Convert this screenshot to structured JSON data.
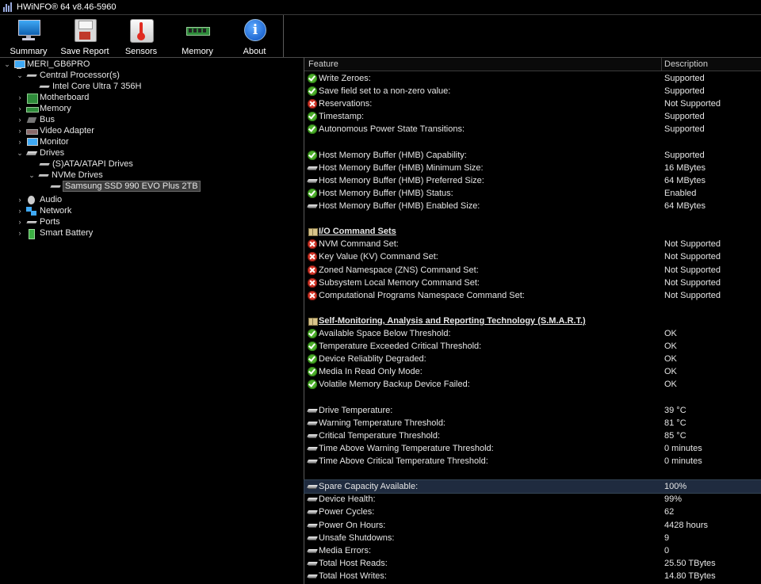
{
  "window": {
    "title": "HWiNFO® 64 v8.46-5960"
  },
  "toolbar": {
    "buttons": [
      {
        "label": "Summary",
        "icon": "monitor-icon"
      },
      {
        "label": "Save Report",
        "icon": "floppy-disk-icon"
      },
      {
        "label": "Sensors",
        "icon": "thermometer-icon"
      },
      {
        "label": "Memory",
        "icon": "memory-module-icon"
      },
      {
        "label": "About",
        "icon": "info-icon"
      }
    ]
  },
  "tree": {
    "root": "MERI_GB6PRO",
    "cpu": "Central Processor(s)",
    "cpu_child": "Intel Core Ultra 7 356H",
    "motherboard": "Motherboard",
    "memory": "Memory",
    "bus": "Bus",
    "video": "Video Adapter",
    "monitor": "Monitor",
    "drives": "Drives",
    "sata": "(S)ATA/ATAPI Drives",
    "nvme": "NVMe Drives",
    "ssd": "Samsung SSD 990 EVO Plus 2TB",
    "audio": "Audio",
    "network": "Network",
    "ports": "Ports",
    "battery": "Smart Battery"
  },
  "details": {
    "header_feature": "Feature",
    "header_description": "Description",
    "rows": [
      {
        "icon": "ok",
        "feature": "Write Zeroes:",
        "value": "Supported"
      },
      {
        "icon": "ok",
        "feature": "Save field set to a non-zero value:",
        "value": "Supported"
      },
      {
        "icon": "no",
        "feature": "Reservations:",
        "value": "Not Supported"
      },
      {
        "icon": "ok",
        "feature": "Timestamp:",
        "value": "Supported"
      },
      {
        "icon": "ok",
        "feature": "Autonomous Power State Transitions:",
        "value": "Supported"
      },
      {
        "icon": "",
        "feature": "",
        "value": ""
      },
      {
        "icon": "ok",
        "feature": "Host Memory Buffer (HMB) Capability:",
        "value": "Supported"
      },
      {
        "icon": "disk",
        "feature": "Host Memory Buffer (HMB) Minimum Size:",
        "value": "16 MBytes"
      },
      {
        "icon": "disk",
        "feature": "Host Memory Buffer (HMB) Preferred Size:",
        "value": "64 MBytes"
      },
      {
        "icon": "ok",
        "feature": "Host Memory Buffer (HMB) Status:",
        "value": "Enabled"
      },
      {
        "icon": "disk",
        "feature": "Host Memory Buffer (HMB) Enabled Size:",
        "value": "64 MBytes"
      },
      {
        "icon": "",
        "feature": "",
        "value": ""
      },
      {
        "icon": "book",
        "feature": "I/O Command Sets",
        "value": "",
        "section": true
      },
      {
        "icon": "no",
        "feature": "NVM Command Set:",
        "value": "Not Supported"
      },
      {
        "icon": "no",
        "feature": "Key Value (KV) Command Set:",
        "value": "Not Supported"
      },
      {
        "icon": "no",
        "feature": "Zoned Namespace (ZNS) Command Set:",
        "value": "Not Supported"
      },
      {
        "icon": "no",
        "feature": "Subsystem Local Memory Command Set:",
        "value": "Not Supported"
      },
      {
        "icon": "no",
        "feature": "Computational Programs Namespace Command Set:",
        "value": "Not Supported"
      },
      {
        "icon": "",
        "feature": "",
        "value": ""
      },
      {
        "icon": "book",
        "feature": "Self-Monitoring, Analysis and Reporting Technology (S.M.A.R.T.)",
        "value": "",
        "section": true
      },
      {
        "icon": "ok",
        "feature": "Available Space Below Threshold:",
        "value": "OK"
      },
      {
        "icon": "ok",
        "feature": "Temperature Exceeded Critical Threshold:",
        "value": "OK"
      },
      {
        "icon": "ok",
        "feature": "Device Reliablity Degraded:",
        "value": "OK"
      },
      {
        "icon": "ok",
        "feature": "Media In Read Only Mode:",
        "value": "OK"
      },
      {
        "icon": "ok",
        "feature": "Volatile Memory Backup Device Failed:",
        "value": "OK"
      },
      {
        "icon": "",
        "feature": "",
        "value": ""
      },
      {
        "icon": "disk",
        "feature": "Drive Temperature:",
        "value": "39 °C"
      },
      {
        "icon": "disk",
        "feature": "Warning Temperature Threshold:",
        "value": "81 °C"
      },
      {
        "icon": "disk",
        "feature": "Critical Temperature Threshold:",
        "value": "85 °C"
      },
      {
        "icon": "disk",
        "feature": "Time Above Warning Temperature Threshold:",
        "value": "0 minutes"
      },
      {
        "icon": "disk",
        "feature": "Time Above Critical Temperature Threshold:",
        "value": "0 minutes"
      },
      {
        "icon": "",
        "feature": "",
        "value": ""
      },
      {
        "icon": "disk",
        "feature": "Spare Capacity Available:",
        "value": "100%",
        "selected": true
      },
      {
        "icon": "disk",
        "feature": "Device Health:",
        "value": "99%"
      },
      {
        "icon": "disk",
        "feature": "Power Cycles:",
        "value": "62"
      },
      {
        "icon": "disk",
        "feature": "Power On Hours:",
        "value": "4428 hours"
      },
      {
        "icon": "disk",
        "feature": "Unsafe Shutdowns:",
        "value": "9"
      },
      {
        "icon": "disk",
        "feature": "Media Errors:",
        "value": "0"
      },
      {
        "icon": "disk",
        "feature": "Total Host Reads:",
        "value": "25.50 TBytes"
      },
      {
        "icon": "disk",
        "feature": "Total Host Writes:",
        "value": "14.80 TBytes"
      }
    ]
  }
}
